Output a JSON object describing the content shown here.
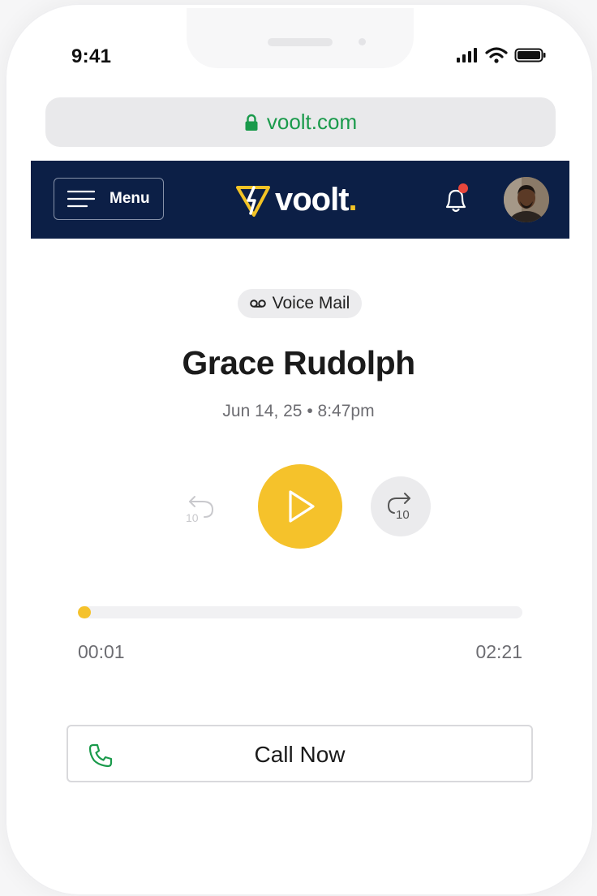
{
  "status_bar": {
    "time": "9:41"
  },
  "browser": {
    "url": "voolt.com"
  },
  "navbar": {
    "menu_label": "Menu",
    "logo_text": "voolt",
    "logo_dot": "."
  },
  "voicemail": {
    "badge_label": "Voice Mail",
    "caller_name": "Grace Rudolph",
    "date": "Jun 14, 25",
    "separator": "•",
    "time": "8:47pm",
    "skip_seconds": "10",
    "progress_fraction": 0.03,
    "elapsed": "00:01",
    "duration": "02:21"
  },
  "actions": {
    "call_label": "Call Now"
  },
  "colors": {
    "accent_yellow": "#f5c22b",
    "navy": "#0c1f46",
    "secure_green": "#1a9a4b",
    "notification_red": "#e8473c"
  }
}
